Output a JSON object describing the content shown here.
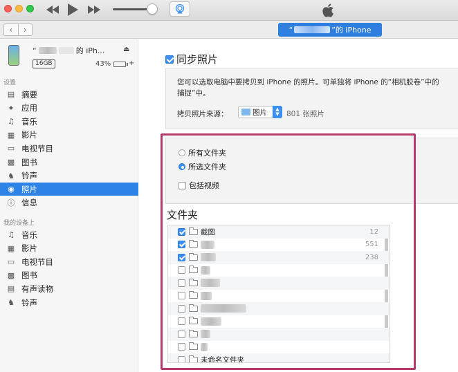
{
  "toolbar": {
    "icons": [
      "close-button",
      "minimize-button",
      "zoom-button",
      "rewind-icon",
      "play-icon",
      "fast-forward-icon",
      "volume-slider",
      "airplay-icon",
      "apple-logo"
    ],
    "volume_fraction": 0.85
  },
  "navbar": {
    "device_pill_prefix": "“",
    "device_pill_suffix": "”的 iPhone"
  },
  "sidebar": {
    "device": {
      "name_prefix": "“",
      "name_suffix": "的 iPh...",
      "capacity": "16GB",
      "battery_percent": "43%",
      "battery_level": 0.43
    },
    "settings_header": "设置",
    "settings_items": [
      {
        "label": "摘要",
        "icon": "summary-icon"
      },
      {
        "label": "应用",
        "icon": "apps-icon"
      },
      {
        "label": "音乐",
        "icon": "music-icon"
      },
      {
        "label": "影片",
        "icon": "movies-icon"
      },
      {
        "label": "电视节目",
        "icon": "tv-icon"
      },
      {
        "label": "图书",
        "icon": "books-icon"
      },
      {
        "label": "铃声",
        "icon": "ringtone-icon"
      },
      {
        "label": "照片",
        "icon": "camera-icon",
        "active": true
      },
      {
        "label": "信息",
        "icon": "info-icon"
      }
    ],
    "ondevice_header": "我的设备上",
    "ondevice_items": [
      {
        "label": "音乐",
        "icon": "music-icon"
      },
      {
        "label": "影片",
        "icon": "movies-icon"
      },
      {
        "label": "电视节目",
        "icon": "tv-icon"
      },
      {
        "label": "图书",
        "icon": "books-icon"
      },
      {
        "label": "有声读物",
        "icon": "audiobook-icon"
      },
      {
        "label": "铃声",
        "icon": "ringtone-icon"
      }
    ]
  },
  "main": {
    "sync_label": "同步照片",
    "sync_checked": true,
    "info_line1": "您可以选取电脑中要拷贝到 iPhone 的照片。可单独将 iPhone 的“相机胶卷”中的",
    "info_line2": "捕捉”中。",
    "source_label": "拷贝照片来源：",
    "source_value": "图片",
    "source_count": "801 张照片",
    "radio_all": "所有文件夹",
    "radio_selected": "所选文件夹",
    "include_video": "包括视频",
    "folders_title": "文件夹",
    "folders": [
      {
        "name": "截图",
        "count": "12",
        "checked": true
      },
      {
        "name": "",
        "count": "551",
        "checked": true
      },
      {
        "name": "",
        "count": "238",
        "checked": true
      },
      {
        "name": "",
        "count": "",
        "checked": false
      },
      {
        "name": "",
        "count": "",
        "checked": false
      },
      {
        "name": "",
        "count": "",
        "checked": false
      },
      {
        "name": "",
        "count": "",
        "checked": false
      },
      {
        "name": "",
        "count": "",
        "checked": false
      },
      {
        "name": "",
        "count": "",
        "checked": false
      },
      {
        "name": "",
        "count": "",
        "checked": false
      },
      {
        "name": "未命名文件夹",
        "count": "",
        "checked": false
      }
    ]
  },
  "colors": {
    "accent": "#2d84e6",
    "highlight_border": "#b63a6c",
    "battery": "#36c64a"
  }
}
